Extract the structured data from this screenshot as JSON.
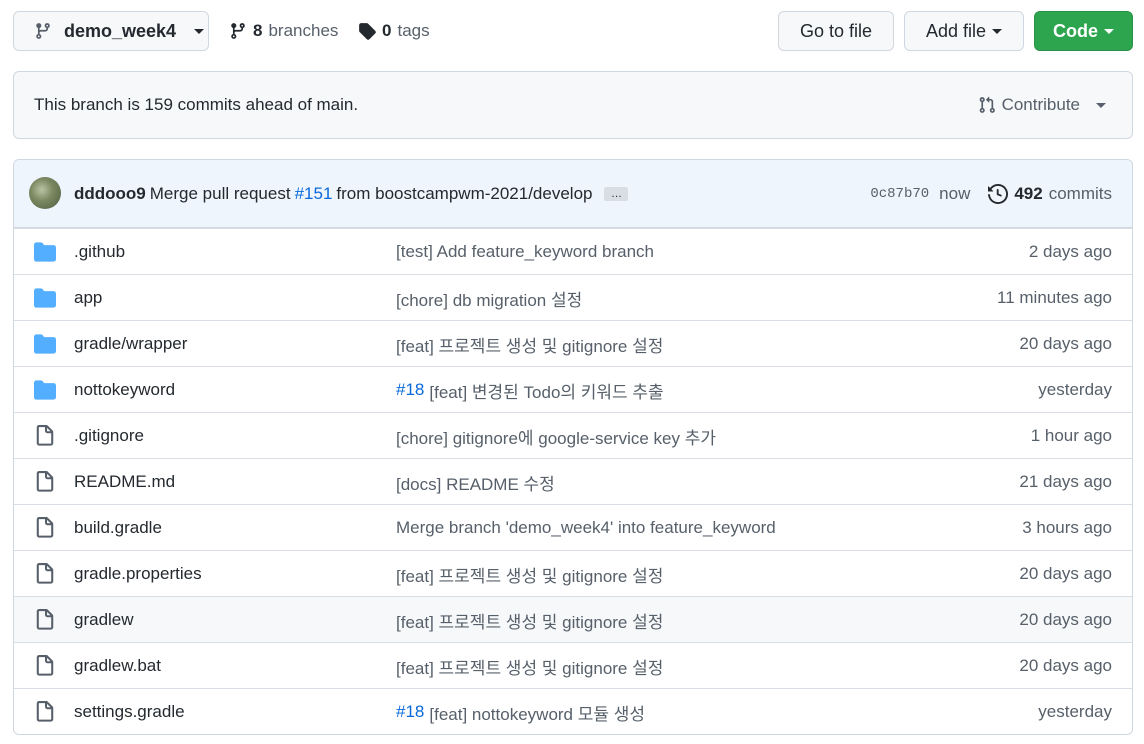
{
  "toolbar": {
    "branch_label": "demo_week4",
    "branches_count": "8",
    "branches_label": "branches",
    "tags_count": "0",
    "tags_label": "tags",
    "go_to_file": "Go to file",
    "add_file": "Add file",
    "code": "Code"
  },
  "ahead": {
    "text": "This branch is 159 commits ahead of main.",
    "contribute": "Contribute"
  },
  "latest_commit": {
    "author": "dddooo9",
    "msg_prefix": "Merge pull request",
    "pr": "#151",
    "msg_suffix": "from boostcampwm-2021/develop",
    "ellipsis": "…",
    "sha": "0c87b70",
    "time": "now",
    "commits_count": "492",
    "commits_label": "commits"
  },
  "files": [
    {
      "type": "dir",
      "name": ".github",
      "issue": "",
      "message": "[test] Add feature_keyword branch",
      "age": "2 days ago"
    },
    {
      "type": "dir",
      "name": "app",
      "issue": "",
      "message": "[chore] db migration 설정",
      "age": "11 minutes ago"
    },
    {
      "type": "dir",
      "name": "gradle/wrapper",
      "issue": "",
      "message": "[feat] 프로젝트 생성 및 gitignore 설정",
      "age": "20 days ago"
    },
    {
      "type": "dir",
      "name": "nottokeyword",
      "issue": "#18",
      "message": "[feat] 변경된 Todo의 키워드 추출",
      "age": "yesterday"
    },
    {
      "type": "file",
      "name": ".gitignore",
      "issue": "",
      "message": "[chore] gitignore에 google-service key 추가",
      "age": "1 hour ago"
    },
    {
      "type": "file",
      "name": "README.md",
      "issue": "",
      "message": "[docs] README 수정",
      "age": "21 days ago"
    },
    {
      "type": "file",
      "name": "build.gradle",
      "issue": "",
      "message": "Merge branch 'demo_week4' into feature_keyword",
      "age": "3 hours ago"
    },
    {
      "type": "file",
      "name": "gradle.properties",
      "issue": "",
      "message": "[feat] 프로젝트 생성 및 gitignore 설정",
      "age": "20 days ago"
    },
    {
      "type": "file",
      "name": "gradlew",
      "issue": "",
      "message": "[feat] 프로젝트 생성 및 gitignore 설정",
      "age": "20 days ago"
    },
    {
      "type": "file",
      "name": "gradlew.bat",
      "issue": "",
      "message": "[feat] 프로젝트 생성 및 gitignore 설정",
      "age": "20 days ago"
    },
    {
      "type": "file",
      "name": "settings.gradle",
      "issue": "#18",
      "message": "[feat] nottokeyword 모듈 생성",
      "age": "yesterday"
    }
  ],
  "colors": {
    "folder": "#54aeff",
    "link": "#0969da",
    "primary": "#2da44e"
  }
}
